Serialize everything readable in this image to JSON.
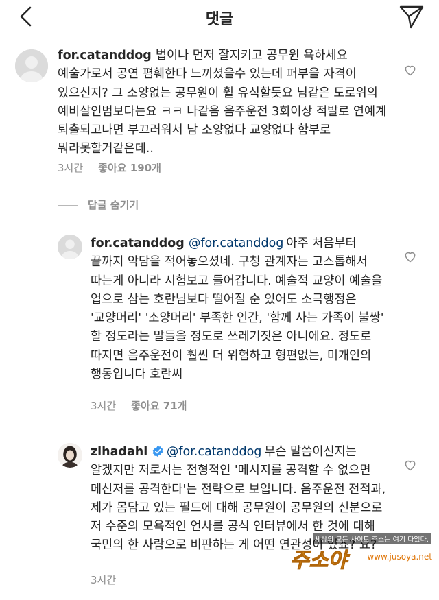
{
  "header": {
    "title": "댓글",
    "back_icon": "chevron-left-icon",
    "share_icon": "paper-plane-icon"
  },
  "comments": [
    {
      "username": "for.catanddog",
      "mention": "",
      "text": "법이나 먼저 잘지키고 공무원 욕하세요 예술가로서 공연 폄훼한다 느끼셨을수 있는데 퍼부을 자격이 있으신지? 그 소양없는 공무원이 훨 유식할듯요 님같은 도로위의 예비살인범보다는요 ㅋㅋ 나같음 음주운전 3회이상 적발로 연예계 퇴출되고나면 부끄러워서 남 소양없다 교양없다 함부로 뭐라못할거같은데..",
      "time": "3시간",
      "likes": "좋아요 190개"
    },
    {
      "username": "for.catanddog",
      "mention": "@for.catanddog",
      "text": "아주 처음부터 끝까지 악담을 적어놓으셨네. 구청 관계자는 고스톱해서 따는게 아니라 시험보고 들어갑니다. 예술적 교양이 예술을 업으로 삼는 호란님보다 떨어질 순 있어도 소극행정은 '교양머리' '소양머리' 부족한 인간, '함께 사는 가족이 불쌍' 할 정도라는 말들을 정도로 쓰레기짓은 아니에요. 정도로 따지면 음주운전이 훨씬 더 위험하고 형편없는, 미개인의 행동입니다 호란씨",
      "time": "3시간",
      "likes": "좋아요 71개"
    },
    {
      "username": "zihadahl",
      "verified": true,
      "mention": "@for.catanddog",
      "text": "무슨 말씀이신지는 알겠지만 저로서는 전형적인 '메시지를 공격할 수 없으면 메신저를 공격한다'는 전략으로 보입니다. 음주운전 전적과, 제가 몸담고 있는 필드에 대해 공무원이 공무원의 신분으로 저 수준의 모욕적인 언사를 공식 인터뷰에서 한 것에 대해 국민의 한 사람으로 비판하는 게 어떤 연관성이 있죠? 요?",
      "time": "3시간",
      "likes": ""
    }
  ],
  "hide_replies": "답글 숨기기",
  "watermark": {
    "top_text": "세상의 모든 사이트 주소는 여기 다있다.",
    "logo": "주소야",
    "url": "www.jusoya.net"
  },
  "colors": {
    "text": "#262626",
    "meta": "#8e8e8e",
    "mention": "#00376b",
    "verified": "#3897f0",
    "border": "#dbdbdb"
  }
}
